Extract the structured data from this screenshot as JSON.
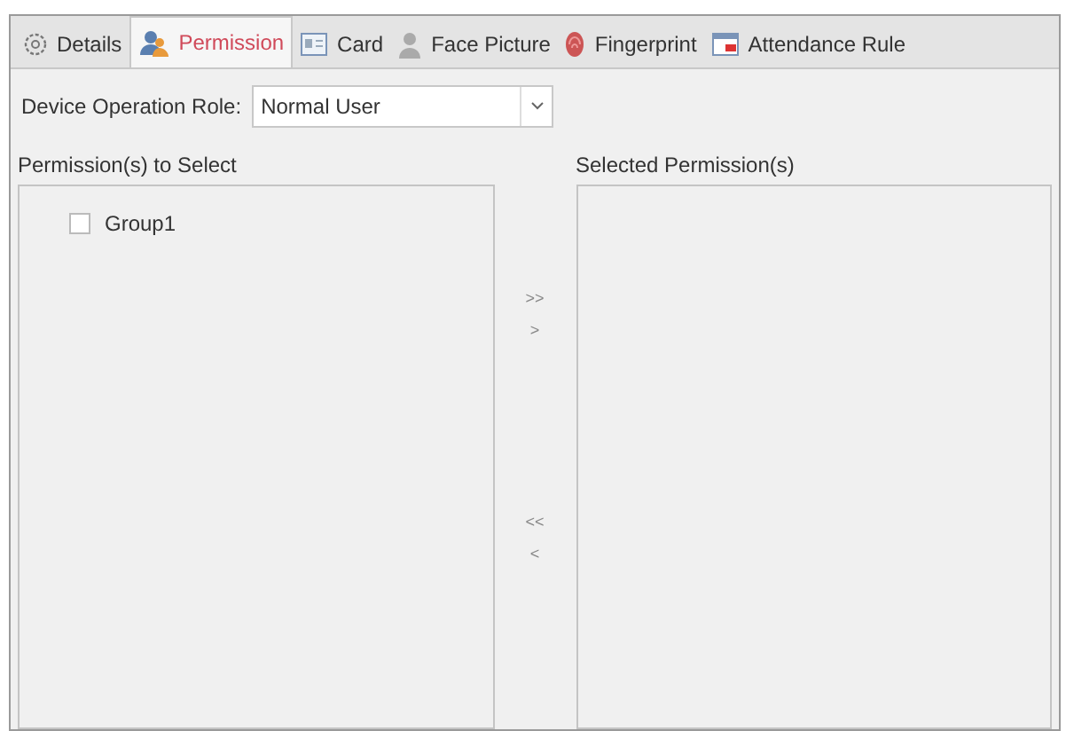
{
  "tabs": [
    {
      "label": "Details",
      "selected": false
    },
    {
      "label": "Permission",
      "selected": true
    },
    {
      "label": "Card",
      "selected": false
    },
    {
      "label": "Face Picture",
      "selected": false
    },
    {
      "label": "Fingerprint",
      "selected": false
    },
    {
      "label": "Attendance Rule",
      "selected": false
    }
  ],
  "role": {
    "label": "Device Operation Role:",
    "value": "Normal User"
  },
  "available": {
    "title": "Permission(s) to Select",
    "items": [
      {
        "label": "Group1",
        "checked": false
      }
    ]
  },
  "selected_list": {
    "title": "Selected Permission(s)"
  },
  "move_buttons": [
    ">>",
    ">",
    "<<",
    "<"
  ]
}
